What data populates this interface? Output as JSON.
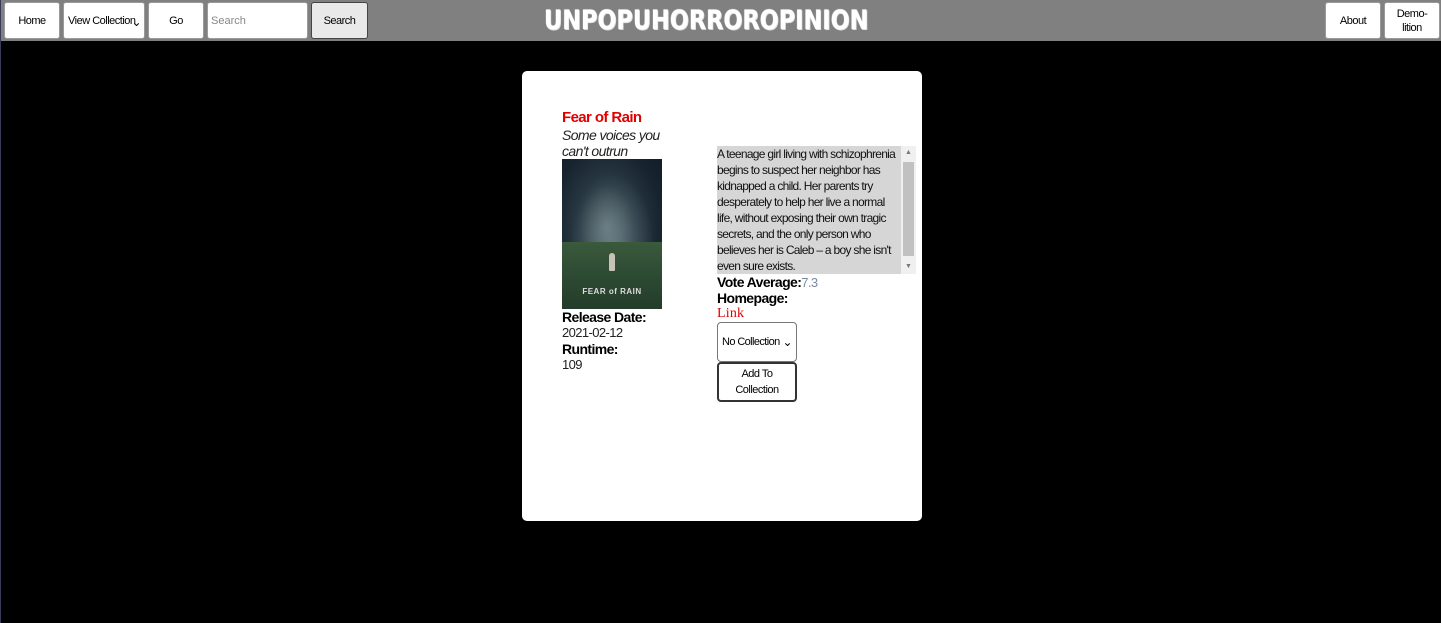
{
  "nav": {
    "home_label": "Home",
    "view_collection_label": "View Collection",
    "go_label": "Go",
    "search_placeholder": "Search",
    "search_label": "Search",
    "site_title": "UNPOPUHORROROPINION",
    "about_label": "About",
    "demolition_label": "Demo-\nlition"
  },
  "movie": {
    "title": "Fear of Rain",
    "tagline": "Some voices you can't outrun",
    "poster_text": "FEAR of RAIN",
    "release_date_label": "Release Date:",
    "release_date": "2021-02-12",
    "runtime_label": "Runtime:",
    "runtime": "109",
    "overview": "A teenage girl living with schizophrenia begins to suspect her neighbor has kidnapped a child. Her parents try desperately to help her live a normal life, without exposing their own tragic secrets, and the only person who believes her is Caleb – a boy she isn't even sure exists.",
    "vote_average_label": "Vote Average:",
    "vote_average": "7.3",
    "homepage_label": "Homepage:",
    "homepage_link_text": "Link"
  },
  "collection": {
    "selected": "No Collection",
    "add_label": "Add To Collection"
  },
  "colors": {
    "title_red": "#e00000",
    "topbar_gray": "#808080",
    "background": "#000000"
  }
}
